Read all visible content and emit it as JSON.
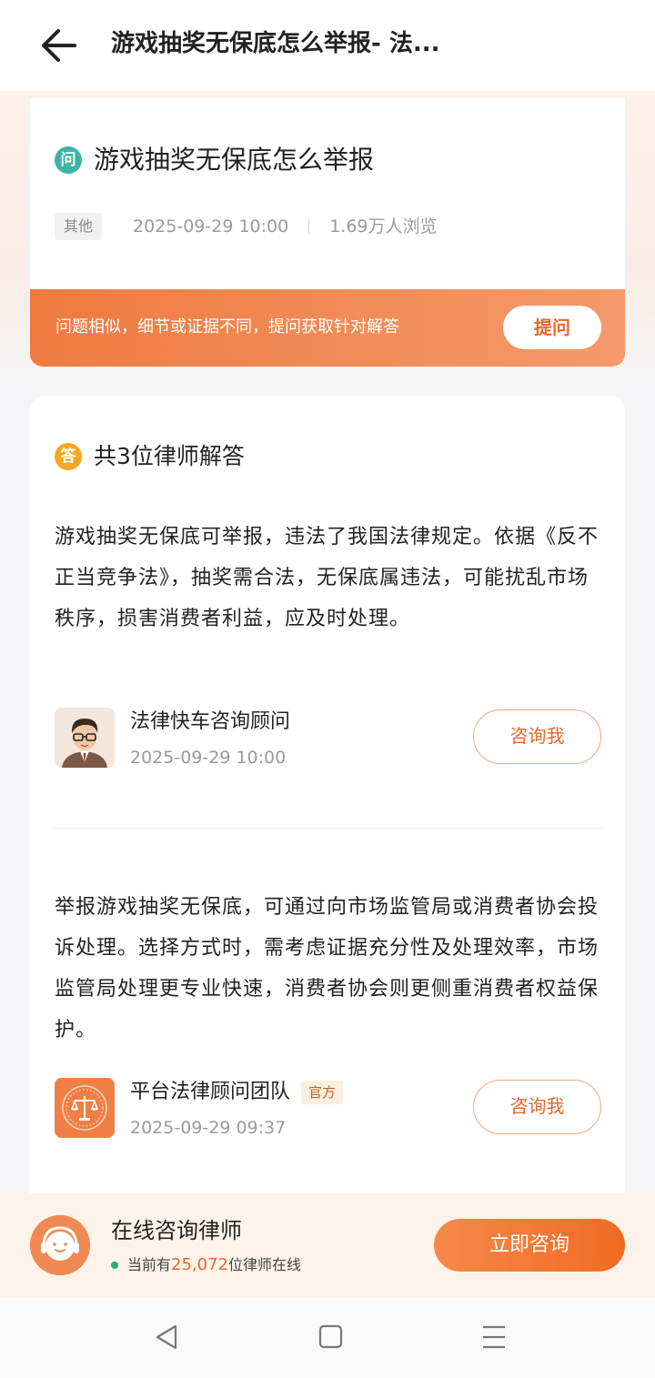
{
  "header": {
    "title": "游戏抽奖无保底怎么举报- 法..."
  },
  "question": {
    "icon_label": "问",
    "title": "游戏抽奖无保底怎么举报",
    "category": "其他",
    "datetime": "2025-09-29  10:00",
    "views": "1.69万人浏览"
  },
  "banner": {
    "text": "问题相似，细节或证据不同，提问获取针对解答",
    "ask_button": "提问"
  },
  "answers_section": {
    "icon_label": "答",
    "heading": "共3位律师解答",
    "answers": [
      {
        "text": "游戏抽奖无保底可举报，违法了我国法律规定。依据《反不正当竞争法》，抽奖需合法，无保底属违法，可能扰乱市场秩序，损害消费者利益，应及时处理。",
        "author": "法律快车咨询顾问",
        "time": "2025-09-29  10:00",
        "consult_label": "咨询我",
        "avatar_icon": "lawyer-cartoon-avatar"
      },
      {
        "text": "举报游戏抽奖无保底，可通过向市场监管局或消费者协会投诉处理。选择方式时，需考虑证据充分性及处理效率，市场监管局处理更专业快速，消费者协会则更侧重消费者权益保护。",
        "author": "平台法律顾问团队",
        "badge": "官方",
        "time": "2025-09-29  09:37",
        "consult_label": "咨询我",
        "avatar_icon": "scales-of-justice-logo"
      }
    ]
  },
  "consult_bar": {
    "title": "在线咨询律师",
    "status_prefix": "当前有",
    "online_count": "25,072",
    "status_suffix": "位律师在线",
    "button": "立即咨询"
  },
  "system_nav": {
    "back": "nav-back-icon",
    "home": "nav-home-icon",
    "menu": "nav-menu-icon"
  },
  "colors": {
    "accent": "#e8672a",
    "question_icon": "#3bb5a5",
    "answer_icon": "#f5a623",
    "online_dot": "#21b07a"
  }
}
